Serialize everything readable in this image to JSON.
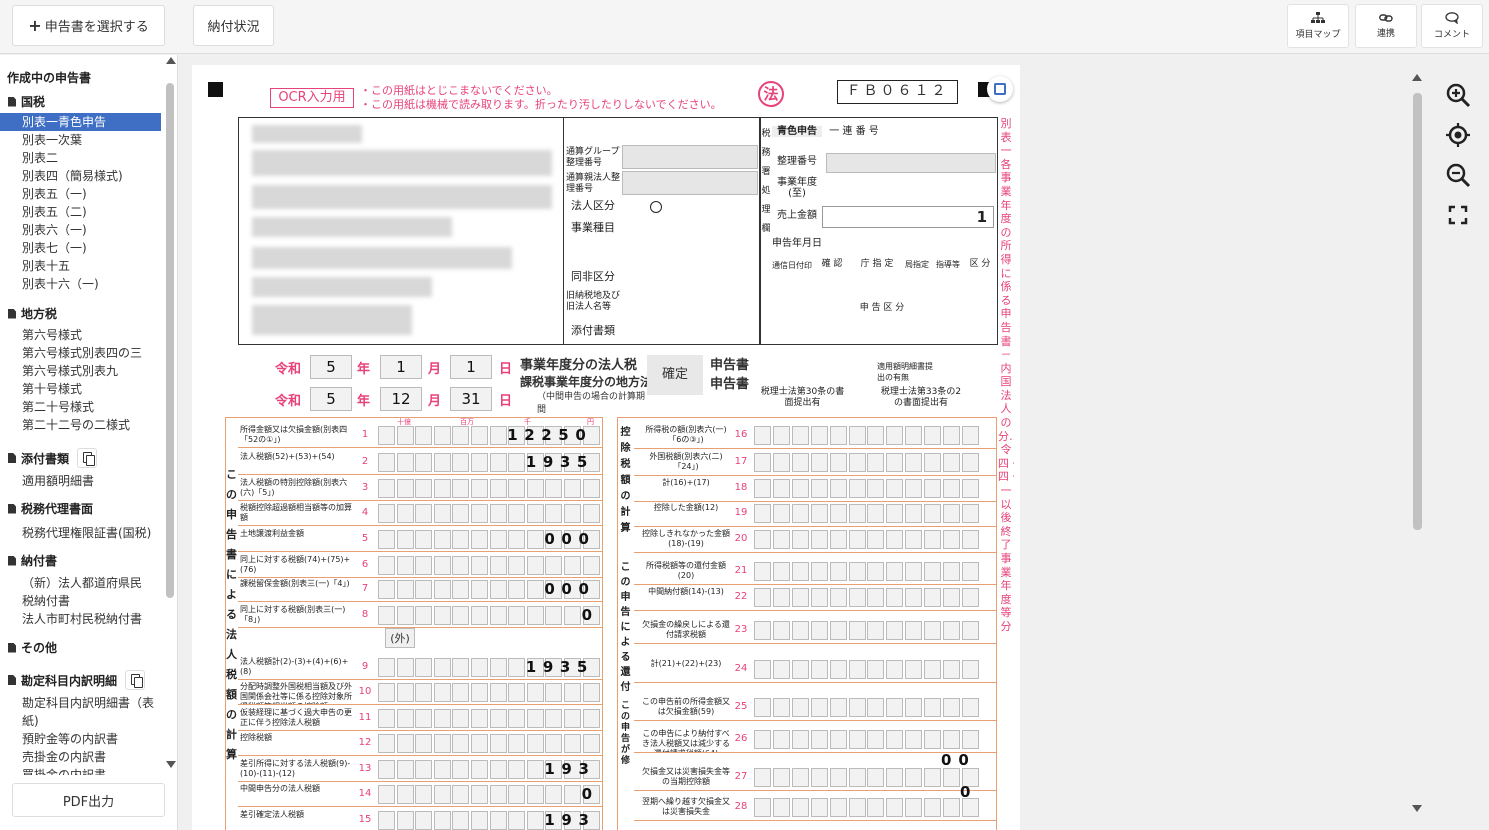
{
  "toolbar": {
    "select_label": "申告書を選択する",
    "tab_label": "納付状況",
    "item_map_label": "項目マップ",
    "link_label": "連携",
    "comment_label": "コメント"
  },
  "sidebar": {
    "title": "作成中の申告書",
    "categories": [
      {
        "label": "国税",
        "items": [
          "別表一青色申告",
          "別表一次葉",
          "別表二",
          "別表四（簡易様式)",
          "別表五（一)",
          "別表五（二)",
          "別表六（一)",
          "別表七（一)",
          "別表十五",
          "別表十六（一)"
        ]
      },
      {
        "label": "地方税",
        "items": [
          "第六号様式",
          "第六号様式別表四の三",
          "第六号様式別表九",
          "第十号様式",
          "第二十号様式",
          "第二十二号の二様式"
        ]
      },
      {
        "label": "添付書類",
        "items": [
          "適用額明細書"
        ]
      },
      {
        "label": "税務代理書面",
        "items": [
          "税務代理権限証書(国税)"
        ]
      },
      {
        "label": "納付書",
        "items": [
          "（新）法人都道府県民税納付書",
          "法人市町村民税納付書"
        ]
      },
      {
        "label": "その他",
        "items": []
      },
      {
        "label": "勘定科目内訳明細",
        "items": [
          "勘定科目内訳明細書（表紙)",
          "預貯金等の内訳書",
          "売掛金の内訳書",
          "買掛金の内訳書"
        ]
      }
    ],
    "pdf_label": "PDF出力"
  },
  "form": {
    "ocr_label": "OCR入力用",
    "notice1": "・この用紙はとじこまないでください。",
    "notice2": "・この用紙は機械で読み取ります。折ったり汚したりしないでください。",
    "hou": "法",
    "form_code": "ＦＢ０６１２",
    "aoiro": "青色申告",
    "serial": "一 連 番 号",
    "seiri": "整理番号",
    "jigyo_nendo": "事業年度(至)",
    "uriage": "売上金額",
    "shinkoku_date": "申告年月日",
    "uriage_val": "1",
    "tsushin": "通信日付印",
    "kakunin": "確 認",
    "chotei": "庁 指 定",
    "kyoku": "局指定",
    "shido": "指導等",
    "kubun": "区 分",
    "shinkoku_kubun": "申 告 区 分",
    "zeimu": "税務署処理欄",
    "group_no": "通算グループ整理番号",
    "oya_no": "通算親法人整理番号",
    "hojin_kubun": "法人区分",
    "jigyo_shumoku": "事業種目",
    "dohi": "同非区分",
    "kyu_nozei": "旧納税地及び旧法人名等",
    "tenpu": "添付書類",
    "reiwa": "令和",
    "nen": "年",
    "tsuki": "月",
    "hi": "日",
    "start": {
      "y": "5",
      "m": "1",
      "d": "1"
    },
    "end": {
      "y": "5",
      "m": "12",
      "d": "31"
    },
    "title1": "事業年度分の法人税",
    "title2": "課税事業年度分の地方法人税",
    "kakutei": "確定",
    "shinkokusho": "申告書",
    "chukan": "（中間申告の場合の計算期間",
    "tekiyo": "適用額明細書提出の有無",
    "zeirishi30": "税理士法第30条の書面提出有",
    "zeirishi33": "税理士法第33条の2の書面提出有",
    "side_title": "別表一 各事業年度の所得に係る申告書－内国法人の分……令四・四・一以後終了事業年度等分",
    "left_section": "この申告書による法人税額の計算",
    "right_sec1": "控除税額の計算",
    "right_sec2": "この申告による還付金額",
    "right_sec3": "この申告が修正申告である場合",
    "sho_label": "(外)",
    "left_rows": [
      {
        "no": "1",
        "label": "所得金額又は欠損金額(別表四「52の①」)",
        "value": "12250"
      },
      {
        "no": "2",
        "label": "法人税額(52)+(53)+(54)",
        "value": "1935"
      },
      {
        "no": "3",
        "label": "法人税額の特別控除額(別表六(六)「5」)",
        "value": ""
      },
      {
        "no": "4",
        "label": "税額控除超過額相当額等の加算額",
        "value": ""
      },
      {
        "no": "5",
        "label": "土地譲渡利益金額",
        "value": "000"
      },
      {
        "no": "6",
        "label": "同上に対する税額(74)+(75)+(76)",
        "value": ""
      },
      {
        "no": "7",
        "label": "課税留保金額(別表三(一)「4」)",
        "value": "000"
      },
      {
        "no": "8",
        "label": "同上に対する税額(別表三(一)「8」)",
        "value": "0"
      },
      {
        "no": "9",
        "label": "法人税額計(2)-(3)+(4)+(6)+(8)",
        "value": "1935"
      },
      {
        "no": "10",
        "label": "分配時調整外国税相当額及び外国関係会社等に係る控除対象所得税額等相当額の控除額",
        "value": ""
      },
      {
        "no": "11",
        "label": "仮装経理に基づく過大申告の更正に伴う控除法人税額",
        "value": ""
      },
      {
        "no": "12",
        "label": "控除税額",
        "value": ""
      },
      {
        "no": "13",
        "label": "差引所得に対する法人税額(9)-(10)-(11)-(12)",
        "value": "193"
      },
      {
        "no": "14",
        "label": "中間申告分の法人税額",
        "value": "0"
      },
      {
        "no": "15",
        "label": "差引確定法人税額",
        "value": "193"
      }
    ],
    "right_rows": [
      {
        "no": "16",
        "label": "所得税の額(別表六(一)「6の③」)"
      },
      {
        "no": "17",
        "label": "外国税額(別表六(二)「24」)"
      },
      {
        "no": "18",
        "label": "計(16)+(17)"
      },
      {
        "no": "19",
        "label": "控除した金額(12)"
      },
      {
        "no": "20",
        "label": "控除しきれなかった金額(18)-(19)"
      },
      {
        "no": "21",
        "label": "所得税額等の還付金額(20)"
      },
      {
        "no": "22",
        "label": "中間納付額(14)-(13)"
      },
      {
        "no": "23",
        "label": "欠損金の繰戻しによる還付請求税額"
      },
      {
        "no": "24",
        "label": "計(21)+(22)+(23)"
      },
      {
        "no": "25",
        "label": "この申告前の所得金額又は欠損金額(59)"
      },
      {
        "no": "26",
        "label": "この申告により納付すべき法人税額又は減少する還付請求税額(64)"
      },
      {
        "no": "27",
        "label": "欠損金又は災害損失金等の当期控除額"
      },
      {
        "no": "28",
        "label": "翌期へ繰り越す欠損金又は災害損失金"
      }
    ],
    "row26_val": "00",
    "row27_val": "0",
    "gaiku": "外",
    "scale": {
      "jukkyo": "十億",
      "hyakuman": "百万",
      "sen": "千",
      "en": "円"
    }
  }
}
